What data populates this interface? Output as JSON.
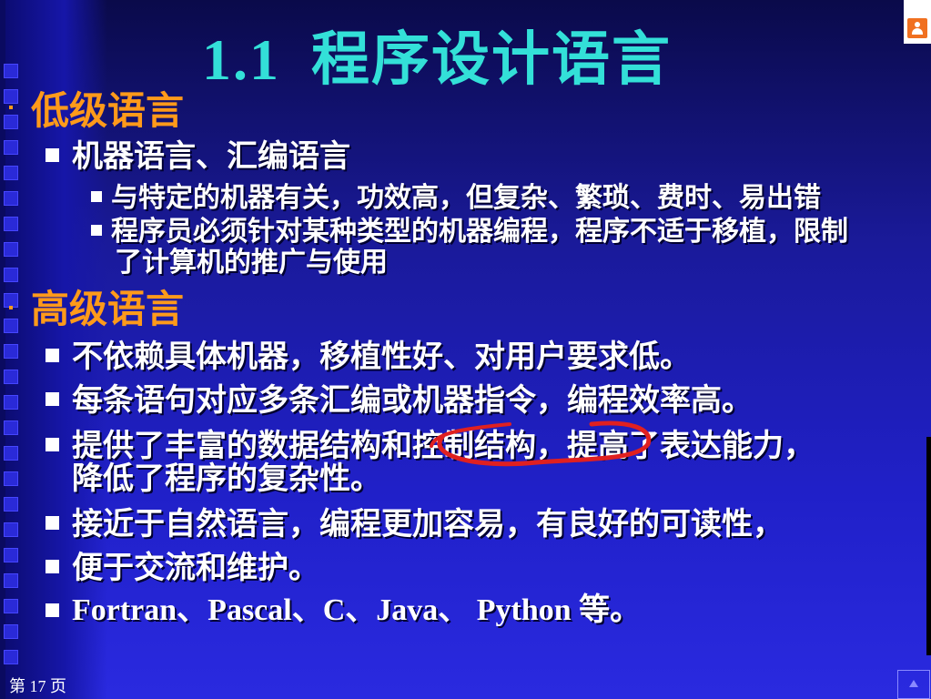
{
  "slide": {
    "title_num": "1.1",
    "title_text": "程序设计语言",
    "footer": "第 17 页",
    "sections": [
      {
        "heading": "低级语言",
        "items": [
          {
            "text": "机器语言、汇编语言",
            "sub": [
              "与特定的机器有关，功效高，但复杂、繁琐、费时、易出错",
              "程序员必须针对某种类型的机器编程，程序不适于移植，限制",
              "了计算机的推广与使用"
            ]
          }
        ]
      },
      {
        "heading": "高级语言",
        "items": [
          "不依赖具体机器，移植性好、对用户要求低。",
          "每条语句对应多条汇编或机器指令，编程效率高。",
          "提供了丰富的数据结构和控制结构，提高了表达能力，",
          "降低了程序的复杂性。",
          "接近于自然语言，编程更加容易，有良好的可读性，",
          "便于交流和维护。",
          "Fortran、Pascal、C、Java、 Python 等。"
        ]
      }
    ]
  },
  "colors": {
    "title": "#33e0d8",
    "heading": "#ff9a1a",
    "text": "#ffffff",
    "annotation": "#e02020"
  },
  "icons": {
    "top_right": "user-avatar-icon",
    "bottom_right": "home-icon"
  }
}
